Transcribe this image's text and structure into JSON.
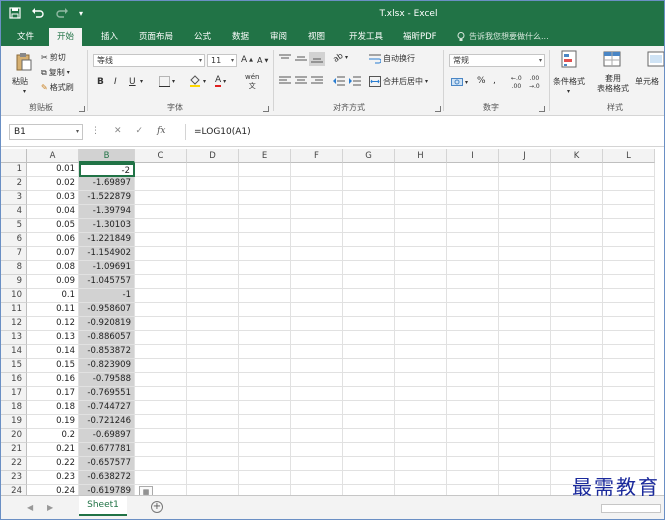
{
  "window": {
    "title": "T.xlsx - Excel"
  },
  "qat": {
    "save_icon": "save-icon",
    "undo_icon": "undo-icon",
    "redo_icon": "redo-icon",
    "customize_icon": "customize-icon"
  },
  "tabs": [
    {
      "label": "文件"
    },
    {
      "label": "开始"
    },
    {
      "label": "插入"
    },
    {
      "label": "页面布局"
    },
    {
      "label": "公式"
    },
    {
      "label": "数据"
    },
    {
      "label": "审阅"
    },
    {
      "label": "视图"
    },
    {
      "label": "开发工具"
    },
    {
      "label": "福昕PDF"
    }
  ],
  "tellme": {
    "placeholder": "告诉我您想要做什么..."
  },
  "ribbon": {
    "clipboard": {
      "label": "剪贴板",
      "paste": "粘贴",
      "cut": "剪切",
      "copy": "复制",
      "format_painter": "格式刷"
    },
    "font": {
      "label": "字体",
      "name": "等线",
      "size": "11",
      "bold": "B",
      "italic": "I",
      "underline": "U"
    },
    "alignment": {
      "label": "对齐方式",
      "wrap": "自动换行",
      "merge": "合并后居中"
    },
    "number": {
      "label": "数字",
      "format": "常规"
    },
    "styles": {
      "label": "样式",
      "conditional": "条件格式",
      "table": "套用\n表格格式",
      "cell": "单元格"
    }
  },
  "formula_bar": {
    "name_box": "B1",
    "formula": "=LOG10(A1)",
    "fx": "fx"
  },
  "columns": [
    "A",
    "B",
    "C",
    "D",
    "E",
    "F",
    "G",
    "H",
    "I",
    "J",
    "K",
    "L"
  ],
  "rows": [
    {
      "n": "1",
      "a": "0.01",
      "b": "-2"
    },
    {
      "n": "2",
      "a": "0.02",
      "b": "-1.69897"
    },
    {
      "n": "3",
      "a": "0.03",
      "b": "-1.522879"
    },
    {
      "n": "4",
      "a": "0.04",
      "b": "-1.39794"
    },
    {
      "n": "5",
      "a": "0.05",
      "b": "-1.30103"
    },
    {
      "n": "6",
      "a": "0.06",
      "b": "-1.221849"
    },
    {
      "n": "7",
      "a": "0.07",
      "b": "-1.154902"
    },
    {
      "n": "8",
      "a": "0.08",
      "b": "-1.09691"
    },
    {
      "n": "9",
      "a": "0.09",
      "b": "-1.045757"
    },
    {
      "n": "10",
      "a": "0.1",
      "b": "-1"
    },
    {
      "n": "11",
      "a": "0.11",
      "b": "-0.958607"
    },
    {
      "n": "12",
      "a": "0.12",
      "b": "-0.920819"
    },
    {
      "n": "13",
      "a": "0.13",
      "b": "-0.886057"
    },
    {
      "n": "14",
      "a": "0.14",
      "b": "-0.853872"
    },
    {
      "n": "15",
      "a": "0.15",
      "b": "-0.823909"
    },
    {
      "n": "16",
      "a": "0.16",
      "b": "-0.79588"
    },
    {
      "n": "17",
      "a": "0.17",
      "b": "-0.769551"
    },
    {
      "n": "18",
      "a": "0.18",
      "b": "-0.744727"
    },
    {
      "n": "19",
      "a": "0.19",
      "b": "-0.721246"
    },
    {
      "n": "20",
      "a": "0.2",
      "b": "-0.69897"
    },
    {
      "n": "21",
      "a": "0.21",
      "b": "-0.677781"
    },
    {
      "n": "22",
      "a": "0.22",
      "b": "-0.657577"
    },
    {
      "n": "23",
      "a": "0.23",
      "b": "-0.638272"
    },
    {
      "n": "24",
      "a": "0.24",
      "b": "-0.619789"
    }
  ],
  "sheets": [
    {
      "label": "Sheet1"
    }
  ],
  "watermark": "最需教育",
  "colors": {
    "accent": "#217346",
    "selection": "#d2d2d2"
  }
}
